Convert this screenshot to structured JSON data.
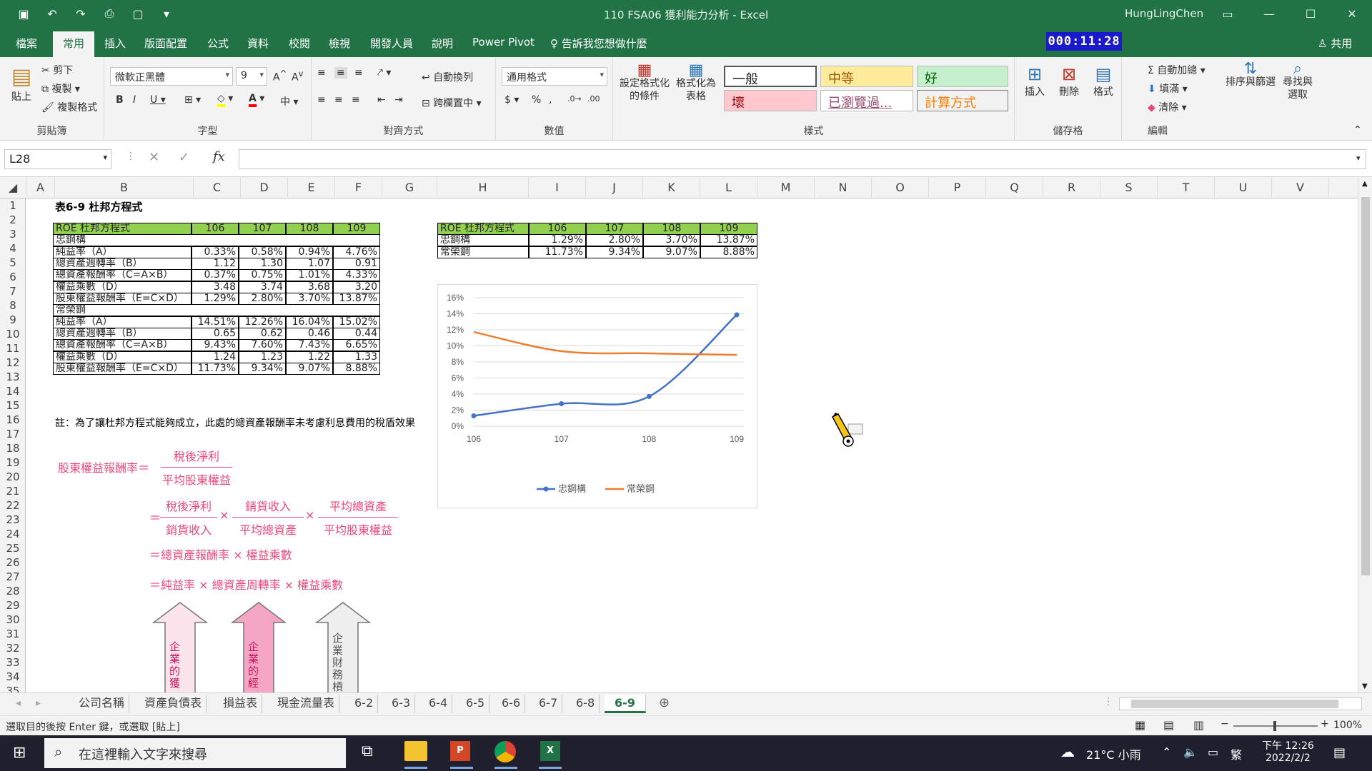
{
  "titlebar": {
    "title": "110 FSA06 獲利能力分析  -  Excel",
    "user": "HungLingChen"
  },
  "tabs": [
    "檔案",
    "常用",
    "插入",
    "版面配置",
    "公式",
    "資料",
    "校閱",
    "檢視",
    "開發人員",
    "說明",
    "Power Pivot"
  ],
  "tell_me": "告訴我您想做什麼",
  "clock_text": "000:11:28",
  "share": "共用",
  "ribbon": {
    "clipboard": {
      "label": "剪貼簿",
      "paste": "貼上",
      "cut": "剪下",
      "copy": "複製",
      "format_painter": "複製格式"
    },
    "font": {
      "label": "字型",
      "name": "微軟正黑體",
      "size": "9"
    },
    "alignment": {
      "label": "對齊方式",
      "wrap": "自動換列",
      "merge": "跨欄置中"
    },
    "number": {
      "label": "數值",
      "format": "通用格式"
    },
    "styles": {
      "label": "樣式",
      "conditional": "設定格式化的條件",
      "as_table": "格式化為表格",
      "normal": "一般",
      "neutral": "中等",
      "good": "好",
      "bad": "壞",
      "visited": "已瀏覽過...",
      "calculation": "計算方式"
    },
    "cells": {
      "label": "儲存格",
      "insert": "插入",
      "delete": "刪除",
      "format": "格式"
    },
    "editing": {
      "label": "編輯",
      "autosum": "自動加總",
      "fill": "填滿",
      "clear": "清除",
      "sort_filter": "排序與篩選",
      "find_select": "尋找與選取"
    }
  },
  "namebox": "L28",
  "columns": [
    "A",
    "B",
    "C",
    "D",
    "E",
    "F",
    "G",
    "H",
    "I",
    "J",
    "K",
    "L",
    "M",
    "N",
    "O",
    "P",
    "Q",
    "R",
    "S",
    "T",
    "U",
    "V"
  ],
  "rows": [
    "1",
    "2",
    "3",
    "4",
    "5",
    "6",
    "7",
    "8",
    "9",
    "10",
    "11",
    "12",
    "13",
    "14",
    "15",
    "16",
    "17",
    "18",
    "19",
    "20",
    "21",
    "22",
    "23",
    "24",
    "25",
    "26",
    "27",
    "28",
    "29",
    "30",
    "31",
    "32",
    "33",
    "34",
    "35"
  ],
  "sheet": {
    "title": "表6-9 杜邦方程式",
    "note": "註：為了讓杜邦方程式能夠成立，此處的總資產報酬率未考慮利息費用的稅盾效果",
    "dupont_table": {
      "header": [
        "ROE 杜邦方程式",
        "106",
        "107",
        "108",
        "109"
      ],
      "rows": [
        [
          "忠鋼構",
          "",
          "",
          "",
          ""
        ],
        [
          "純益率（A）",
          "0.33%",
          "0.58%",
          "0.94%",
          "4.76%"
        ],
        [
          "總資產週轉率（B）",
          "1.12",
          "1.30",
          "1.07",
          "0.91"
        ],
        [
          "總資產報酬率（C=A×B）",
          "0.37%",
          "0.75%",
          "1.01%",
          "4.33%"
        ],
        [
          "權益乘數（D）",
          "3.48",
          "3.74",
          "3.68",
          "3.20"
        ],
        [
          "股東權益報酬率（E=C×D）",
          "1.29%",
          "2.80%",
          "3.70%",
          "13.87%"
        ],
        [
          "常榮鋼",
          "",
          "",
          "",
          ""
        ],
        [
          "純益率（A）",
          "14.51%",
          "12.26%",
          "16.04%",
          "15.02%"
        ],
        [
          "總資產週轉率（B）",
          "0.65",
          "0.62",
          "0.46",
          "0.44"
        ],
        [
          "總資產報酬率（C=A×B）",
          "9.43%",
          "7.60%",
          "7.43%",
          "6.65%"
        ],
        [
          "權益乘數（D）",
          "1.24",
          "1.23",
          "1.22",
          "1.33"
        ],
        [
          "股東權益報酬率（E=C×D）",
          "11.73%",
          "9.34%",
          "9.07%",
          "8.88%"
        ]
      ]
    },
    "roe_table": {
      "header": [
        "ROE 杜邦方程式",
        "106",
        "107",
        "108",
        "109"
      ],
      "rows": [
        [
          "忠鋼構",
          "1.29%",
          "2.80%",
          "3.70%",
          "13.87%"
        ],
        [
          "常榮鋼",
          "11.73%",
          "9.34%",
          "9.07%",
          "8.88%"
        ]
      ]
    },
    "formula": {
      "roe_label": "股東權益報酬率＝",
      "num1": "稅後淨利",
      "den1": "平均股東權益",
      "f2_n1": "稅後淨利",
      "f2_d1": "銷貨收入",
      "f2_n2": "銷貨收入",
      "f2_d2": "平均總資產",
      "f2_n3": "平均總資產",
      "f2_d3": "平均股東權益",
      "eq": "＝",
      "times": "×",
      "line3": "＝總資產報酬率 × 權益乘數",
      "line4": "＝純益率 × 總資產周轉率 × 權益乘數"
    },
    "arrows": [
      "企業的獲",
      "企業的經",
      "企業財務槓"
    ]
  },
  "chart_data": {
    "type": "line",
    "x": [
      "106",
      "107",
      "108",
      "109"
    ],
    "series": [
      {
        "name": "忠鋼構",
        "values": [
          1.29,
          2.8,
          3.7,
          13.87
        ],
        "color": "#4472c4"
      },
      {
        "name": "常榮鋼",
        "values": [
          11.73,
          9.34,
          9.07,
          8.88
        ],
        "color": "#ed7d31"
      }
    ],
    "ylim": [
      0,
      16
    ],
    "yticks": [
      "0%",
      "2%",
      "4%",
      "6%",
      "8%",
      "10%",
      "12%",
      "14%",
      "16%"
    ],
    "grid": true,
    "legend": "bottom"
  },
  "sheet_tabs": [
    "公司名稱",
    "資產負債表",
    "損益表",
    "現金流量表",
    "6-2",
    "6-3",
    "6-4",
    "6-5",
    "6-6",
    "6-7",
    "6-8",
    "6-9"
  ],
  "active_sheet": "6-9",
  "status": {
    "message": "選取目的後按 Enter 鍵，或選取 [貼上]",
    "zoom": "100%"
  },
  "taskbar": {
    "search_placeholder": "在這裡輸入文字來搜尋",
    "weather": "21°C 小雨",
    "ime": "繁",
    "time": "下午 12:26",
    "date": "2022/2/2"
  }
}
